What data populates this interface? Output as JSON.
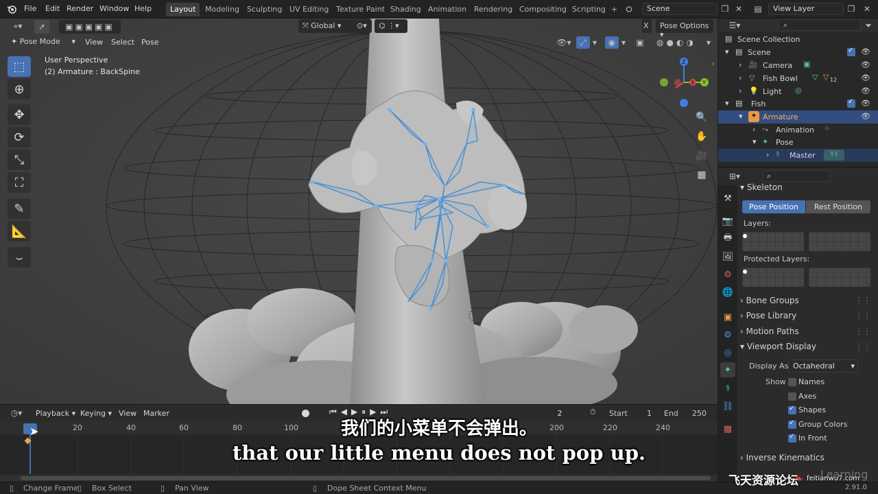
{
  "menubar": {
    "items": [
      "File",
      "Edit",
      "Render",
      "Window",
      "Help"
    ],
    "workspaces": [
      "Layout",
      "Modeling",
      "Sculpting",
      "UV Editing",
      "Texture Paint",
      "Shading",
      "Animation",
      "Rendering",
      "Compositing",
      "Scripting"
    ],
    "active_workspace": "Layout",
    "add_tab": "+",
    "scene": "Scene",
    "view_layer": "View Layer"
  },
  "viewport": {
    "mode": "Pose Mode",
    "menus": [
      "View",
      "Select",
      "Pose"
    ],
    "transform_orientation": "Global",
    "pose_options": "Pose Options",
    "x_label": "X",
    "info_line1": "User Perspective",
    "info_line2": "(2) Armature : BackSpine"
  },
  "outliner": {
    "rows": [
      {
        "label": "Scene Collection"
      },
      {
        "label": "Scene"
      },
      {
        "label": "Camera"
      },
      {
        "label": "Fish Bowl"
      },
      {
        "label": "Light"
      },
      {
        "label": "Fish"
      },
      {
        "label": "Armature"
      },
      {
        "label": "Animation"
      },
      {
        "label": "Pose"
      },
      {
        "label": "Master"
      }
    ],
    "fishbowl_badge": "12"
  },
  "properties": {
    "panel_skeleton": "Skeleton",
    "pose_position": "Pose Position",
    "rest_position": "Rest Position",
    "layers_label": "Layers:",
    "protected_layers_label": "Protected Layers:",
    "bone_groups": "Bone Groups",
    "pose_library": "Pose Library",
    "motion_paths": "Motion Paths",
    "viewport_display": "Viewport Display",
    "display_as_label": "Display As",
    "display_as_value": "Octahedral",
    "show_label": "Show",
    "show_items": [
      {
        "label": "Names",
        "checked": false
      },
      {
        "label": "Axes",
        "checked": false
      },
      {
        "label": "Shapes",
        "checked": true
      },
      {
        "label": "Group Colors",
        "checked": true
      },
      {
        "label": "In Front",
        "checked": true
      }
    ],
    "inverse_kinematics": "Inverse Kinematics"
  },
  "timeline": {
    "menus": [
      "Playback",
      "Keying",
      "View",
      "Marker"
    ],
    "current_frame": "2",
    "start_label": "Start",
    "start_value": "1",
    "end_label": "End",
    "end_value": "250",
    "ruler": [
      "20",
      "40",
      "60",
      "80",
      "100",
      "200",
      "220",
      "240"
    ]
  },
  "statusbar": {
    "items": [
      "Change Frame",
      "Box Select",
      "Pan View",
      "Dope Sheet Context Menu"
    ],
    "version": "2.91.0"
  },
  "subtitles": {
    "zh": "我们的小菜单不会弹出。",
    "en": "that our little menu does not pop up."
  },
  "watermark": {
    "text": "飞天资源论坛",
    "url": "feitianwu7.com",
    "learning": "Learning"
  },
  "colors": {
    "accent": "#4772b3",
    "selection": "#334d80",
    "bone": "#5fa8e0",
    "gizmo_x": "#d84a4a",
    "gizmo_y": "#8bbf2e",
    "gizmo_z": "#3f7fe0"
  }
}
